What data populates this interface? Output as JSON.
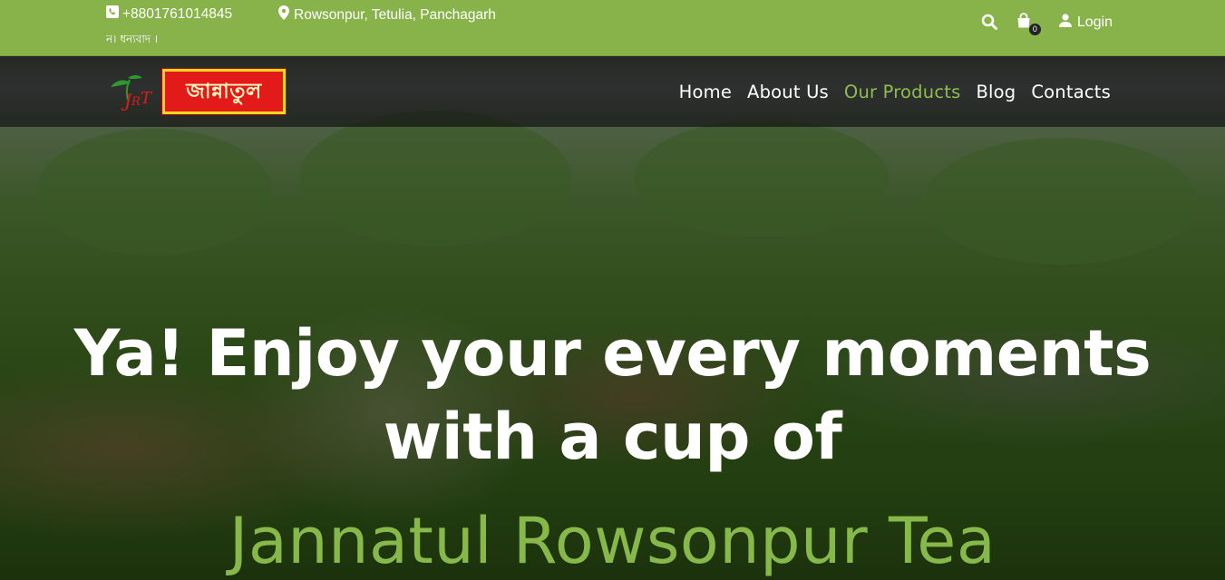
{
  "topbar": {
    "phone": "+8801761014845",
    "address": "Rowsonpur, Tetulia, Panchagarh",
    "marquee": "ন। ধন্যবাদ ।",
    "cart_count": "0",
    "login_label": "Login"
  },
  "logo": {
    "mark_text": "JRT",
    "brand_text": "জান্নাতুল"
  },
  "nav": {
    "items": [
      {
        "label": "Home"
      },
      {
        "label": "About Us"
      },
      {
        "label": "Our Products"
      },
      {
        "label": "Blog"
      },
      {
        "label": "Contacts"
      }
    ],
    "active_index": 2
  },
  "hero": {
    "line1": "Ya! Enjoy your every moments",
    "line2": "with a cup of",
    "brand": "Jannatul Rowsonpur Tea"
  },
  "colors": {
    "topbar_bg": "#88b34a",
    "accent_green": "#86b84a",
    "logo_red": "#e31a1a",
    "logo_yellow": "#f2d81e"
  },
  "icons": {
    "phone": "phone-square-icon",
    "location": "map-marker-icon",
    "search": "search-icon",
    "cart": "shopping-bag-icon",
    "user": "user-icon"
  }
}
